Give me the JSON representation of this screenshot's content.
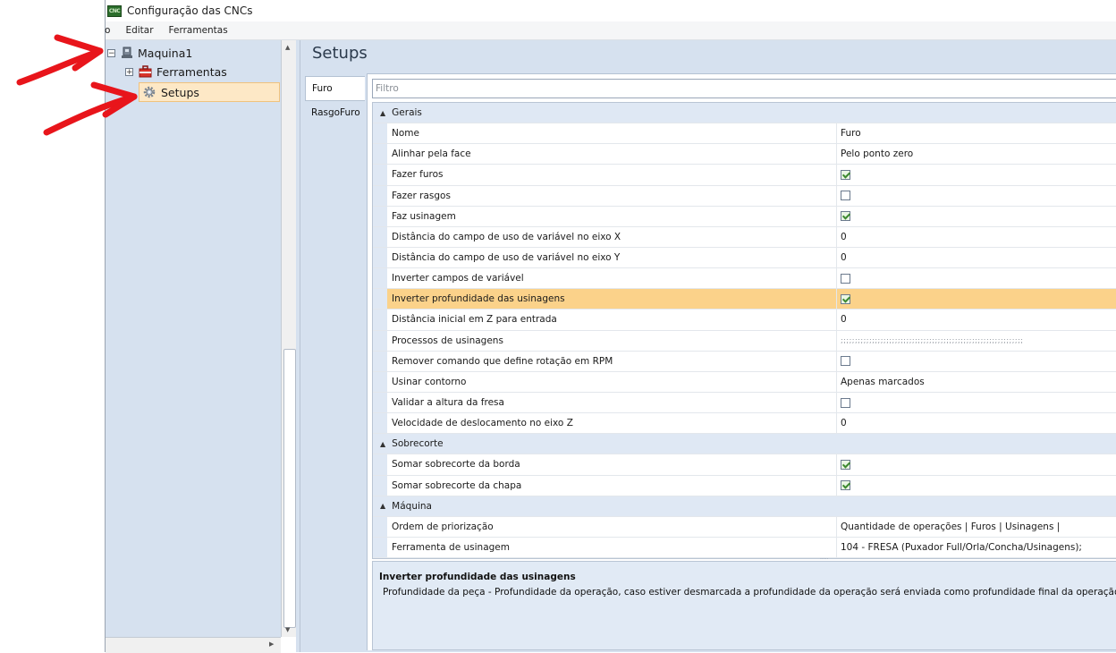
{
  "window": {
    "title": "Configuração das CNCs",
    "icon_text": "CNC"
  },
  "menu": [
    "o",
    "Editar",
    "Ferramentas"
  ],
  "tree": {
    "root": {
      "label": "Maquina1",
      "expander": "⊟"
    },
    "items": [
      {
        "label": "Ferramentas",
        "expander": "⊞"
      },
      {
        "label": "Setups"
      }
    ]
  },
  "setups": {
    "title": "Setups",
    "tabs": [
      "Furo",
      "RasgoFuro"
    ],
    "filter_placeholder": "Filtro",
    "categories": [
      {
        "name": "Gerais",
        "rows": [
          {
            "name": "Nome",
            "value": "Furo"
          },
          {
            "name": "Alinhar pela face",
            "value": "Pelo ponto zero"
          },
          {
            "name": "Fazer furos",
            "checked": true
          },
          {
            "name": "Fazer rasgos",
            "checked": false
          },
          {
            "name": "Faz usinagem",
            "checked": true
          },
          {
            "name": "Distância do campo de uso de variável no eixo X",
            "value": "0"
          },
          {
            "name": "Distância do campo de uso de variável no eixo Y",
            "value": "0"
          },
          {
            "name": "Inverter campos de variável",
            "checked": false
          },
          {
            "name": "Inverter profundidade das usinagens",
            "checked": true,
            "selected": true
          },
          {
            "name": "Distância inicial em Z para entrada",
            "value": "0"
          },
          {
            "name": "Processos de usinagens",
            "value": ";;;;;;;;;;;;;;;;;;;;;;;;;;;;;;;;;;;;;;;;;;;;;;;;;;;;;;;;;;;;;;;;"
          },
          {
            "name": "Remover comando que define rotação em RPM",
            "checked": false
          },
          {
            "name": "Usinar contorno",
            "value": "Apenas marcados"
          },
          {
            "name": "Validar a altura da fresa",
            "checked": false
          },
          {
            "name": "Velocidade de deslocamento no eixo Z",
            "value": "0"
          }
        ]
      },
      {
        "name": "Sobrecorte",
        "rows": [
          {
            "name": "Somar sobrecorte da borda",
            "checked": true
          },
          {
            "name": "Somar sobrecorte da chapa",
            "checked": true
          }
        ]
      },
      {
        "name": "Máquina",
        "rows": [
          {
            "name": "Ordem de priorização",
            "value": "Quantidade de operações | Furos | Usinagens |"
          },
          {
            "name": "Ferramenta de usinagem",
            "value": "104 - FRESA (Puxador Full/Orla/Concha/Usinagens);"
          }
        ]
      }
    ],
    "description": {
      "title": "Inverter profundidade das usinagens",
      "text": "Profundidade da peça - Profundidade da operação, caso estiver desmarcada a profundidade da operação será enviada como profundidade final da operação."
    }
  },
  "colors": {
    "selection": "#fccf7f",
    "panel": "#d6e1ef",
    "arrow": "#e8151b"
  }
}
